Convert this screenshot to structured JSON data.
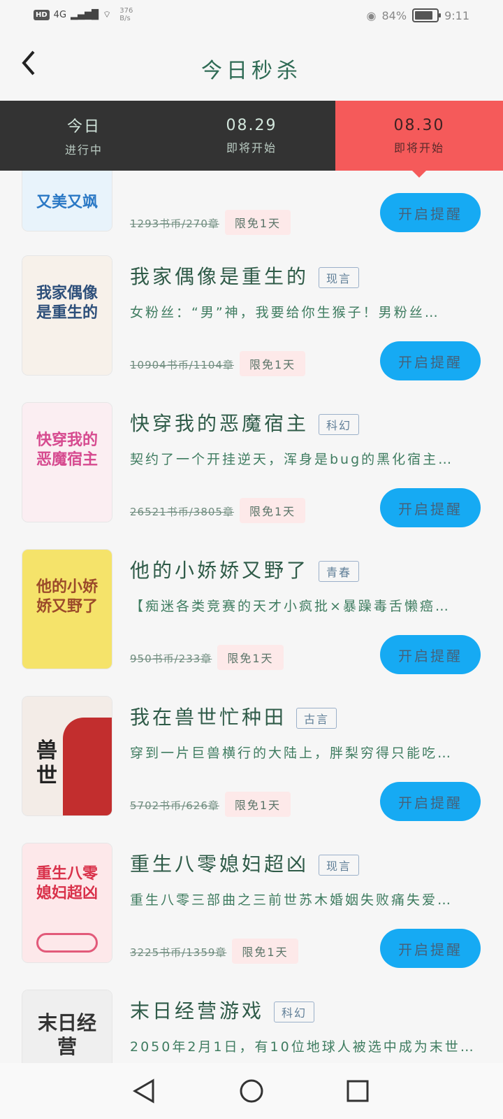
{
  "status": {
    "network": "4G",
    "speed_top": "376",
    "speed_unit": "B/s",
    "battery_percent": "84%",
    "battery_level": 0.84,
    "time": "9:11"
  },
  "header": {
    "title": "今日秒杀"
  },
  "tabs": [
    {
      "label": "今日",
      "sub": "进行中"
    },
    {
      "label": "08.29",
      "sub": "即将开始"
    },
    {
      "label": "08.30",
      "sub": "即将开始"
    }
  ],
  "books": [
    {
      "title": "",
      "tag": "",
      "desc": "",
      "price": "1293书币/270章",
      "badge": "限免1天",
      "button": "开启提醒",
      "cover_text": "又美又飒",
      "cover_color": "#e8f3fb"
    },
    {
      "title": "我家偶像是重生的",
      "tag": "现言",
      "desc": "女粉丝：“男”神，我要给你生猴子！男粉丝…",
      "price": "10904书币/1104章",
      "badge": "限免1天",
      "button": "开启提醒",
      "cover_text": "我家偶像是重生的",
      "cover_color": "#f7f1ea"
    },
    {
      "title": "快穿我的恶魔宿主",
      "tag": "科幻",
      "desc": "契约了一个开挂逆天，浑身是bug的黑化宿主…",
      "price": "26521书币/3805章",
      "badge": "限免1天",
      "button": "开启提醒",
      "cover_text": "快穿我的恶魔宿主",
      "cover_color": "#fbeef2"
    },
    {
      "title": "他的小娇娇又野了",
      "tag": "青春",
      "desc": "【痴迷各类竞赛的天才小疯批×暴躁毒舌懒癌…",
      "price": "950书币/233章",
      "badge": "限免1天",
      "button": "开启提醒",
      "cover_text": "他的小娇娇又野了",
      "cover_color": "#f5e36a"
    },
    {
      "title": "我在兽世忙种田",
      "tag": "古言",
      "desc": "穿到一片巨兽横行的大陆上，胖梨穷得只能吃…",
      "price": "5702书币/626章",
      "badge": "限免1天",
      "button": "开启提醒",
      "cover_text": "兽世",
      "cover_color": "#f3ece7"
    },
    {
      "title": "重生八零媳妇超凶",
      "tag": "现言",
      "desc": "重生八零三部曲之三前世苏木婚姻失败痛失爱…",
      "price": "3225书币/1359章",
      "badge": "限免1天",
      "button": "开启提醒",
      "cover_text": "重生八零媳妇超凶",
      "cover_color": "#fde8ea"
    },
    {
      "title": "末日经营游戏",
      "tag": "科幻",
      "desc": "2050年2月1日，有10位地球人被选中成为末世…",
      "price": "",
      "badge": "",
      "button": "",
      "cover_text": "末日经营",
      "cover_color": "#efefef"
    }
  ],
  "colors": {
    "accent_tab": "#f55a5a",
    "button": "#16aaf3",
    "tab_bar": "#333333"
  }
}
